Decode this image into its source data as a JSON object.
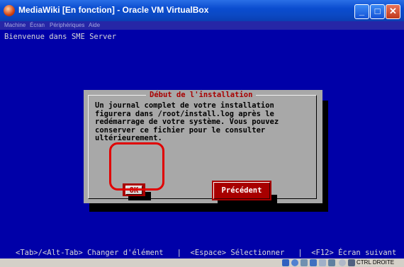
{
  "window": {
    "title": "MediaWiki [En fonction] - Oracle VM VirtualBox",
    "controls": {
      "minimize": "_",
      "maximize": "□",
      "close": "✕"
    }
  },
  "menubar": {
    "items": [
      "Machine",
      "Écran",
      "Périphériques",
      "Aide"
    ]
  },
  "console": {
    "welcome": "Bienvenue dans SME Server",
    "dialog": {
      "title": "Début de l'installation",
      "body": "Un journal complet de votre installation\nfigurera dans /root/install.log après le\nredémarrage de votre système. Vous pouvez\nconserver ce fichier pour le consulter\nultérieurement.",
      "ok_label": "OK",
      "prev_label": "Précédent"
    },
    "status_line": "<Tab>/<Alt-Tab> Changer d'élément   |  <Espace> Sélectionner   |  <F12> Écran suivant"
  },
  "taskbar": {
    "host_key": "CTRL DROITE"
  },
  "colors": {
    "console_bg": "#0000a8",
    "dialog_bg": "#a8a8a8",
    "button_red": "#a80000",
    "highlight": "#e00000"
  }
}
